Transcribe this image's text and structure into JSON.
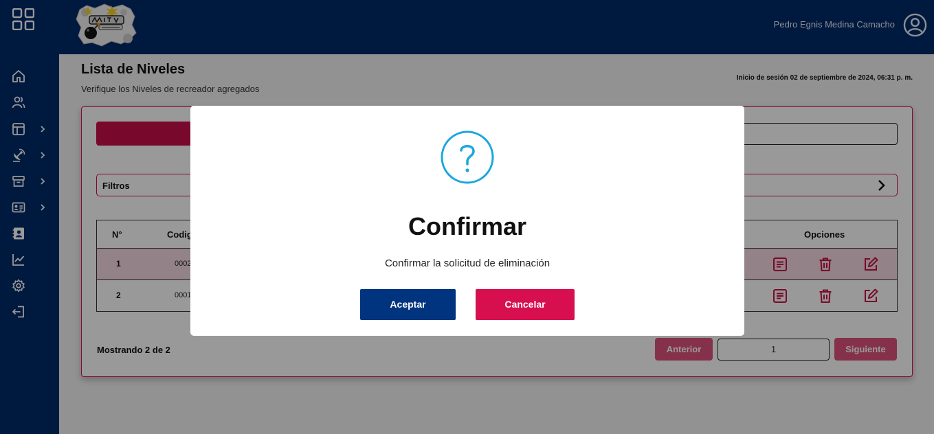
{
  "header": {
    "user_name": "Pedro Egnis Medina Camacho"
  },
  "sidebar": {
    "items": [
      {
        "icon": "home-icon",
        "has_submenu": false
      },
      {
        "icon": "users-icon",
        "has_submenu": false
      },
      {
        "icon": "layout-icon",
        "has_submenu": true
      },
      {
        "icon": "satellite-dish-icon",
        "has_submenu": true
      },
      {
        "icon": "archive-box-icon",
        "has_submenu": true
      },
      {
        "icon": "id-card-icon",
        "has_submenu": true
      },
      {
        "icon": "contact-book-icon",
        "has_submenu": false
      },
      {
        "icon": "chart-line-icon",
        "has_submenu": false
      },
      {
        "icon": "gear-icon",
        "has_submenu": false
      },
      {
        "icon": "logout-icon",
        "has_submenu": false
      }
    ]
  },
  "page": {
    "title": "Lista de Niveles",
    "subtitle": "Verifique los Niveles de recreador agregados",
    "session": "Inicio de sesión 02 de septiembre de 2024, 06:31 p. m."
  },
  "filters": {
    "label": "Filtros"
  },
  "table": {
    "headers": {
      "n": "N°",
      "code": "Codig",
      "options": "Opciones"
    },
    "rows": [
      {
        "n": "1",
        "code": "0002"
      },
      {
        "n": "2",
        "code": "0001"
      }
    ]
  },
  "pagination": {
    "showing": "Mostrando 2 de 2",
    "prev": "Anterior",
    "page": "1",
    "next": "Siguiente"
  },
  "modal": {
    "icon": "question-icon",
    "title": "Confirmar",
    "message": "Confirmar la solicitud de eliminación",
    "accept": "Aceptar",
    "cancel": "Cancelar"
  },
  "colors": {
    "navy": "#002b69",
    "crimson": "#d70f4f",
    "info": "#1aa7e0"
  }
}
